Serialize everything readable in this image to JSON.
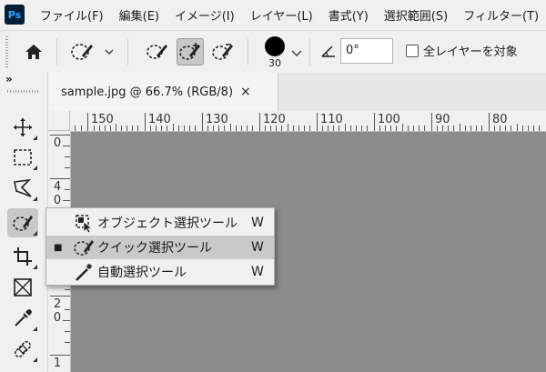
{
  "app": {
    "logo": "Ps"
  },
  "menu": [
    "ファイル(F)",
    "編集(E)",
    "イメージ(I)",
    "レイヤー(L)",
    "書式(Y)",
    "選択範囲(S)",
    "フィルター(T)"
  ],
  "options_bar": {
    "brush_size": "30",
    "angle_value": "0°",
    "sample_all_layers_label": "全レイヤーを対象"
  },
  "tools_panel": {
    "collapse_glyph": "»"
  },
  "document": {
    "tab_title": "sample.jpg @ 66.7% (RGB/8)",
    "close_glyph": "×",
    "ruler_top_labels": [
      "150",
      "140",
      "130",
      "120",
      "110",
      "100",
      "90",
      "80"
    ],
    "ruler_left_labels": [
      {
        "lines": [
          "0"
        ]
      },
      {
        "lines": [
          "4",
          "0"
        ]
      },
      {
        "lines": [
          "2",
          "0"
        ]
      },
      {
        "lines": [
          "1"
        ]
      }
    ]
  },
  "flyout": {
    "items": [
      {
        "label": "オブジェクト選択ツール",
        "shortcut": "W",
        "icon": "object-selection-icon",
        "selected": false
      },
      {
        "label": "クイック選択ツール",
        "shortcut": "W",
        "icon": "quick-selection-icon",
        "selected": true
      },
      {
        "label": "自動選択ツール",
        "shortcut": "W",
        "icon": "magic-wand-icon",
        "selected": false
      }
    ],
    "selected_marker": "■"
  },
  "colors": {
    "canvas": "#8c8c8c",
    "panel": "#f0f0f0",
    "ps_logo_bg": "#001e36",
    "ps_logo_fg": "#31a8ff",
    "active_tool": "#c8c8c8"
  }
}
